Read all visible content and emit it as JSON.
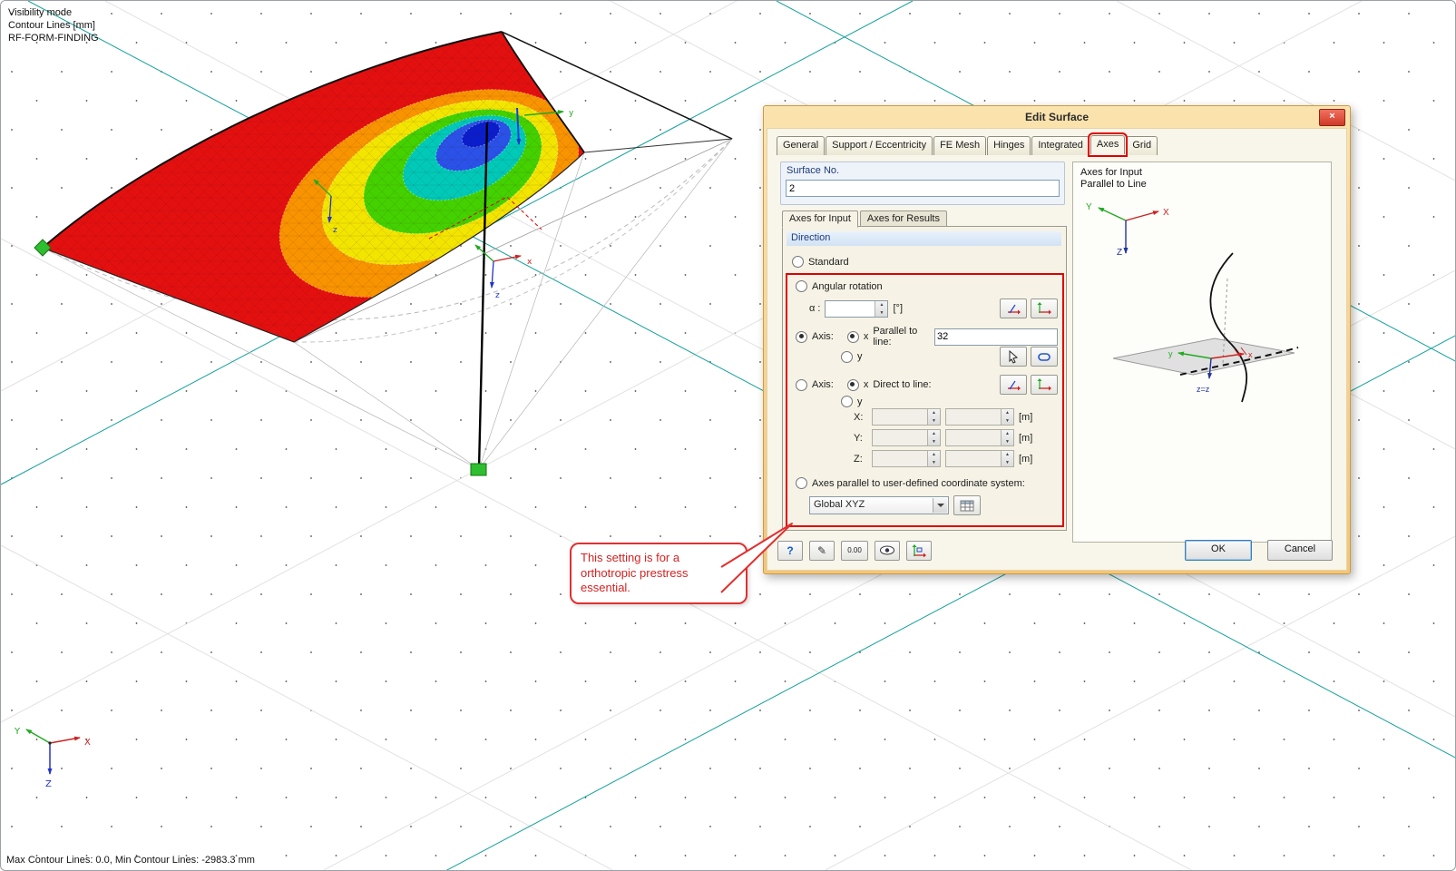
{
  "viewport": {
    "legend": [
      "Visibility mode",
      "Contour Lines [mm]",
      "RF-FORM-FINDING"
    ],
    "status": "Max Contour Lines: 0.0, Min Contour Lines: -2983.3 mm",
    "triad": {
      "x": "X",
      "y": "Y",
      "z": "Z"
    },
    "model_labels": {
      "x": "x",
      "y": "y",
      "z": "z"
    },
    "colors": {
      "band_red": "#e31010",
      "band_orange": "#f79400",
      "band_yellow": "#f2e500",
      "band_green": "#43d100",
      "band_cyan": "#00c9b8",
      "band_blue": "#2a52e8",
      "band_navy": "#0b1ecc"
    }
  },
  "icons": {
    "close": "×",
    "spin_up": "▲",
    "spin_down": "▼",
    "help": "?",
    "edit": "✎"
  },
  "dialog": {
    "title": "Edit Surface",
    "tabs": [
      "General",
      "Support / Eccentricity",
      "FE Mesh",
      "Hinges",
      "Integrated",
      "Axes",
      "Grid"
    ],
    "surface": {
      "label": "Surface No.",
      "value": "2"
    },
    "subtabs": [
      "Axes for Input",
      "Axes for Results"
    ],
    "direction": {
      "header": "Direction",
      "standard": "Standard",
      "angular": "Angular rotation",
      "alpha_label": "α :",
      "alpha_value": "",
      "deg_unit": "[°]",
      "axis1_label": "Axis:",
      "axis2_label": "Axis:",
      "x_label": "x",
      "y_label": "y",
      "parallel_label": "Parallel to line:",
      "parallel_value": "32",
      "direct_label": "Direct to line:",
      "coords": [
        {
          "label": "X:",
          "unit": "[m]",
          "v1": "",
          "v2": ""
        },
        {
          "label": "Y:",
          "unit": "[m]",
          "v1": "",
          "v2": ""
        },
        {
          "label": "Z:",
          "unit": "[m]",
          "v1": "",
          "v2": ""
        }
      ],
      "user_defined_label": "Axes parallel to user-defined coordinate system:",
      "combo_value": "Global XYZ"
    },
    "right_panel": {
      "line1": "Axes for Input",
      "line2": "Parallel to Line",
      "x": "X",
      "y": "Y",
      "z": "Z",
      "plane_x": "x",
      "plane_y": "y",
      "plane_z": "z=z"
    },
    "footer": {
      "decimal": "0.00",
      "ok": "OK",
      "cancel": "Cancel"
    }
  },
  "callout": {
    "text": "This setting is for a orthotropic prestress essential."
  }
}
